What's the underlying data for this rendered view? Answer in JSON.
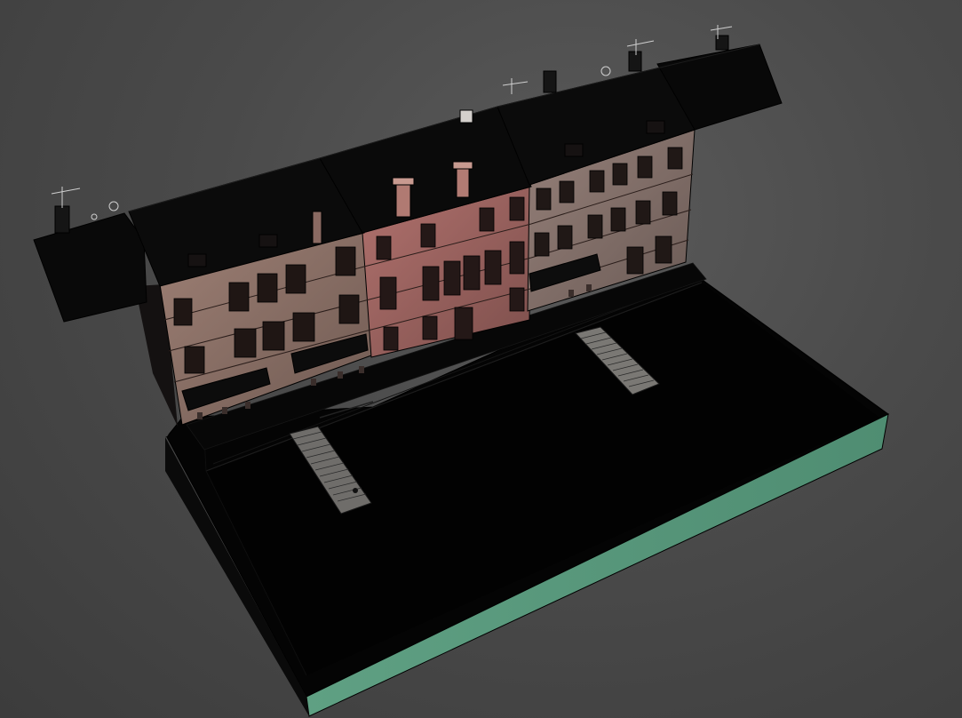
{
  "viewport": {
    "background": "#4a4a4a",
    "render_mode": "shaded-edged-faces"
  },
  "scene": {
    "colors": {
      "base_side": "#5d9a80",
      "base_top": "#050505",
      "roof": "#0b0b0b",
      "facade_beige": "#8e7468",
      "facade_pink": "#a56a68",
      "facade_grey": "#8a7771",
      "window": "#1d1615",
      "stairs": "#7c7a76",
      "edge": "#000000"
    },
    "objects": [
      "ground-slab",
      "canal-basin",
      "quay-left-stairs",
      "quay-right-stairs",
      "building-row",
      "roof-row",
      "chimneys",
      "weather-vanes",
      "awnings"
    ]
  }
}
